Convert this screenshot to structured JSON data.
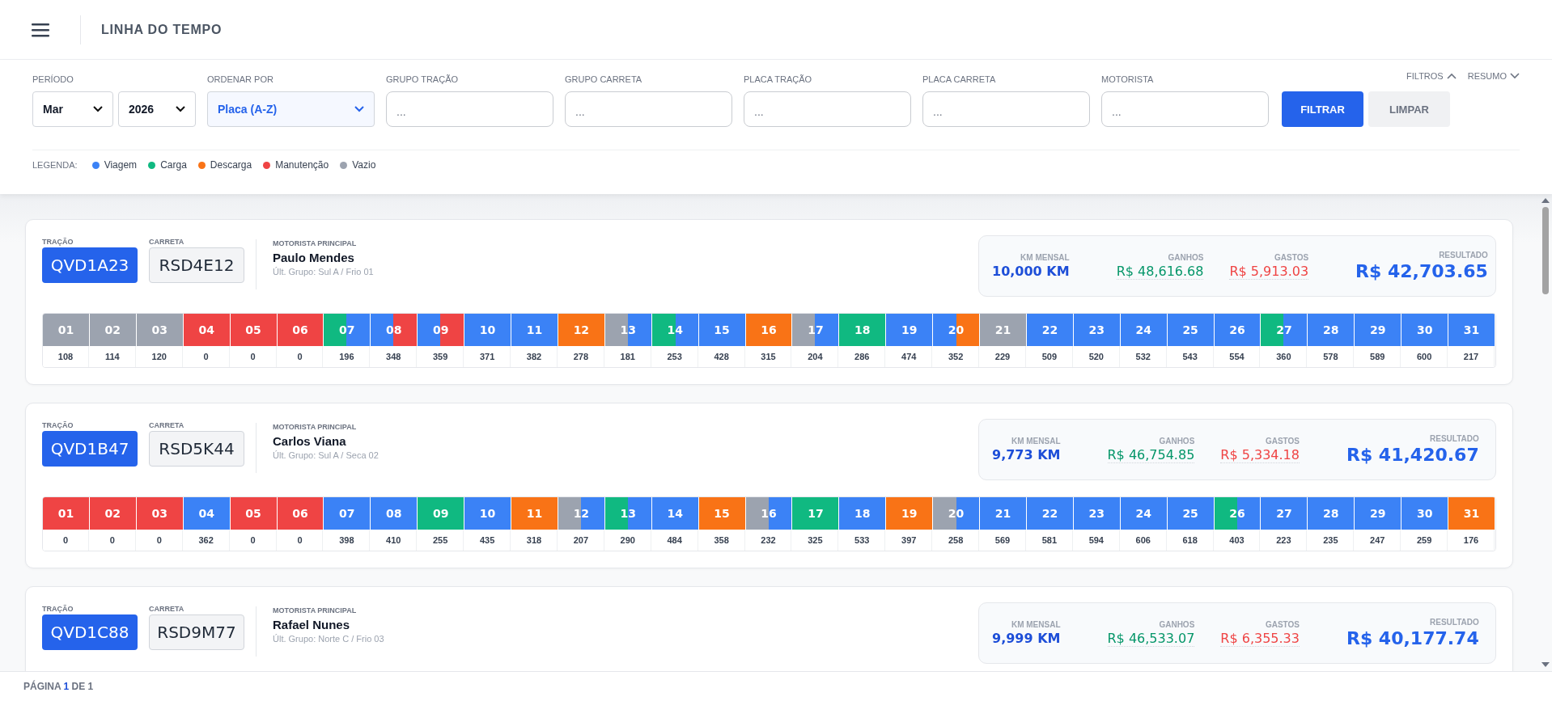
{
  "header": {
    "title": "LINHA DO TEMPO"
  },
  "filters": {
    "period_label": "PERÍODO",
    "month": "Mar",
    "year": "2026",
    "order_label": "ORDENAR POR",
    "order": "Placa (A-Z)",
    "fields": [
      {
        "label": "GRUPO TRAÇÃO",
        "placeholder": "..."
      },
      {
        "label": "GRUPO CARRETA",
        "placeholder": "..."
      },
      {
        "label": "PLACA TRAÇÃO",
        "placeholder": "..."
      },
      {
        "label": "PLACA CARRETA",
        "placeholder": "..."
      },
      {
        "label": "MOTORISTA",
        "placeholder": "..."
      }
    ],
    "filter_button": "FILTRAR",
    "clear_button": "LIMPAR",
    "toggles": [
      {
        "label": "FILTROS",
        "expanded": true
      },
      {
        "label": "RESUMO",
        "expanded": false
      }
    ]
  },
  "legend": {
    "label": "LEGENDA:",
    "items": [
      {
        "kind": "viagem",
        "label": "Viagem",
        "color": "#3b82f6"
      },
      {
        "kind": "carga",
        "label": "Carga",
        "color": "#10b981"
      },
      {
        "kind": "descarga",
        "label": "Descarga",
        "color": "#f97316"
      },
      {
        "kind": "manutencao",
        "label": "Manutenção",
        "color": "#ef4444"
      },
      {
        "kind": "vazio",
        "label": "Vazio",
        "color": "#9ca3af"
      }
    ]
  },
  "cards": [
    {
      "tracao_label": "TRAÇÃO",
      "tracao": "QVD1A23",
      "carreta_label": "CARRETA",
      "carreta": "RSD4E12",
      "driver_label": "MOTORISTA PRINCIPAL",
      "driver": "Paulo Mendes",
      "group": "Últ. Grupo: Sul A / Frio 01",
      "km_label": "KM MENSAL",
      "km": "10,000 KM",
      "gain_label": "GANHOS",
      "gain": "R$ 48,616.68",
      "cost_label": "GASTOS",
      "cost": "R$ 5,913.03",
      "result_label": "RESULTADO",
      "result": "R$ 42,703.65",
      "days": [
        {
          "day": "01",
          "km": "108",
          "segments": [
            {
              "kind": "vazio"
            }
          ]
        },
        {
          "day": "02",
          "km": "114",
          "segments": [
            {
              "kind": "vazio"
            }
          ]
        },
        {
          "day": "03",
          "km": "120",
          "segments": [
            {
              "kind": "vazio"
            }
          ]
        },
        {
          "day": "04",
          "km": "0",
          "segments": [
            {
              "kind": "manutencao"
            }
          ]
        },
        {
          "day": "05",
          "km": "0",
          "segments": [
            {
              "kind": "manutencao"
            }
          ]
        },
        {
          "day": "06",
          "km": "0",
          "segments": [
            {
              "kind": "manutencao"
            }
          ]
        },
        {
          "day": "07",
          "km": "196",
          "segments": [
            {
              "kind": "carga"
            },
            {
              "kind": "viagem"
            }
          ]
        },
        {
          "day": "08",
          "km": "348",
          "segments": [
            {
              "kind": "viagem"
            },
            {
              "kind": "manutencao"
            }
          ]
        },
        {
          "day": "09",
          "km": "359",
          "segments": [
            {
              "kind": "viagem"
            },
            {
              "kind": "manutencao"
            }
          ]
        },
        {
          "day": "10",
          "km": "371",
          "segments": [
            {
              "kind": "viagem"
            }
          ]
        },
        {
          "day": "11",
          "km": "382",
          "segments": [
            {
              "kind": "viagem"
            }
          ]
        },
        {
          "day": "12",
          "km": "278",
          "segments": [
            {
              "kind": "descarga"
            }
          ]
        },
        {
          "day": "13",
          "km": "181",
          "segments": [
            {
              "kind": "vazio"
            },
            {
              "kind": "viagem"
            }
          ]
        },
        {
          "day": "14",
          "km": "253",
          "segments": [
            {
              "kind": "carga"
            },
            {
              "kind": "viagem"
            }
          ]
        },
        {
          "day": "15",
          "km": "428",
          "segments": [
            {
              "kind": "viagem"
            }
          ]
        },
        {
          "day": "16",
          "km": "315",
          "segments": [
            {
              "kind": "descarga"
            }
          ]
        },
        {
          "day": "17",
          "km": "204",
          "segments": [
            {
              "kind": "vazio"
            },
            {
              "kind": "viagem"
            }
          ]
        },
        {
          "day": "18",
          "km": "286",
          "segments": [
            {
              "kind": "carga"
            }
          ]
        },
        {
          "day": "19",
          "km": "474",
          "segments": [
            {
              "kind": "viagem"
            }
          ]
        },
        {
          "day": "20",
          "km": "352",
          "segments": [
            {
              "kind": "viagem"
            },
            {
              "kind": "descarga"
            }
          ]
        },
        {
          "day": "21",
          "km": "229",
          "segments": [
            {
              "kind": "vazio"
            }
          ]
        },
        {
          "day": "22",
          "km": "509",
          "segments": [
            {
              "kind": "viagem"
            }
          ]
        },
        {
          "day": "23",
          "km": "520",
          "segments": [
            {
              "kind": "viagem"
            }
          ]
        },
        {
          "day": "24",
          "km": "532",
          "segments": [
            {
              "kind": "viagem"
            }
          ]
        },
        {
          "day": "25",
          "km": "543",
          "segments": [
            {
              "kind": "viagem"
            }
          ]
        },
        {
          "day": "26",
          "km": "554",
          "segments": [
            {
              "kind": "viagem"
            }
          ]
        },
        {
          "day": "27",
          "km": "360",
          "segments": [
            {
              "kind": "carga"
            },
            {
              "kind": "viagem"
            }
          ]
        },
        {
          "day": "28",
          "km": "578",
          "segments": [
            {
              "kind": "viagem"
            }
          ]
        },
        {
          "day": "29",
          "km": "589",
          "segments": [
            {
              "kind": "viagem"
            }
          ]
        },
        {
          "day": "30",
          "km": "600",
          "segments": [
            {
              "kind": "viagem"
            }
          ]
        },
        {
          "day": "31",
          "km": "217",
          "segments": [
            {
              "kind": "viagem"
            }
          ]
        }
      ]
    },
    {
      "tracao_label": "TRAÇÃO",
      "tracao": "QVD1B47",
      "carreta_label": "CARRETA",
      "carreta": "RSD5K44",
      "driver_label": "MOTORISTA PRINCIPAL",
      "driver": "Carlos Viana",
      "group": "Últ. Grupo: Sul A / Seca 02",
      "km_label": "KM MENSAL",
      "km": "9,773 KM",
      "gain_label": "GANHOS",
      "gain": "R$ 46,754.85",
      "cost_label": "GASTOS",
      "cost": "R$ 5,334.18",
      "result_label": "RESULTADO",
      "result": "R$ 41,420.67",
      "days": [
        {
          "day": "01",
          "km": "0",
          "segments": [
            {
              "kind": "manutencao"
            }
          ]
        },
        {
          "day": "02",
          "km": "0",
          "segments": [
            {
              "kind": "manutencao"
            }
          ]
        },
        {
          "day": "03",
          "km": "0",
          "segments": [
            {
              "kind": "manutencao"
            }
          ]
        },
        {
          "day": "04",
          "km": "362",
          "segments": [
            {
              "kind": "viagem"
            }
          ]
        },
        {
          "day": "05",
          "km": "0",
          "segments": [
            {
              "kind": "manutencao"
            }
          ]
        },
        {
          "day": "06",
          "km": "0",
          "segments": [
            {
              "kind": "manutencao"
            }
          ]
        },
        {
          "day": "07",
          "km": "398",
          "segments": [
            {
              "kind": "viagem"
            }
          ]
        },
        {
          "day": "08",
          "km": "410",
          "segments": [
            {
              "kind": "viagem"
            }
          ]
        },
        {
          "day": "09",
          "km": "255",
          "segments": [
            {
              "kind": "carga"
            }
          ]
        },
        {
          "day": "10",
          "km": "435",
          "segments": [
            {
              "kind": "viagem"
            }
          ]
        },
        {
          "day": "11",
          "km": "318",
          "segments": [
            {
              "kind": "descarga"
            }
          ]
        },
        {
          "day": "12",
          "km": "207",
          "segments": [
            {
              "kind": "vazio"
            },
            {
              "kind": "viagem"
            }
          ]
        },
        {
          "day": "13",
          "km": "290",
          "segments": [
            {
              "kind": "carga"
            },
            {
              "kind": "viagem"
            }
          ]
        },
        {
          "day": "14",
          "km": "484",
          "segments": [
            {
              "kind": "viagem"
            }
          ]
        },
        {
          "day": "15",
          "km": "358",
          "segments": [
            {
              "kind": "descarga"
            }
          ]
        },
        {
          "day": "16",
          "km": "232",
          "segments": [
            {
              "kind": "vazio"
            },
            {
              "kind": "viagem"
            }
          ]
        },
        {
          "day": "17",
          "km": "325",
          "segments": [
            {
              "kind": "carga"
            }
          ]
        },
        {
          "day": "18",
          "km": "533",
          "segments": [
            {
              "kind": "viagem"
            }
          ]
        },
        {
          "day": "19",
          "km": "397",
          "segments": [
            {
              "kind": "descarga"
            }
          ]
        },
        {
          "day": "20",
          "km": "258",
          "segments": [
            {
              "kind": "vazio"
            },
            {
              "kind": "viagem"
            }
          ]
        },
        {
          "day": "21",
          "km": "569",
          "segments": [
            {
              "kind": "viagem"
            }
          ]
        },
        {
          "day": "22",
          "km": "581",
          "segments": [
            {
              "kind": "viagem"
            }
          ]
        },
        {
          "day": "23",
          "km": "594",
          "segments": [
            {
              "kind": "viagem"
            }
          ]
        },
        {
          "day": "24",
          "km": "606",
          "segments": [
            {
              "kind": "viagem"
            }
          ]
        },
        {
          "day": "25",
          "km": "618",
          "segments": [
            {
              "kind": "viagem"
            }
          ]
        },
        {
          "day": "26",
          "km": "403",
          "segments": [
            {
              "kind": "carga"
            },
            {
              "kind": "viagem"
            }
          ]
        },
        {
          "day": "27",
          "km": "223",
          "segments": [
            {
              "kind": "viagem"
            }
          ]
        },
        {
          "day": "28",
          "km": "235",
          "segments": [
            {
              "kind": "viagem"
            }
          ]
        },
        {
          "day": "29",
          "km": "247",
          "segments": [
            {
              "kind": "viagem"
            }
          ]
        },
        {
          "day": "30",
          "km": "259",
          "segments": [
            {
              "kind": "viagem"
            }
          ]
        },
        {
          "day": "31",
          "km": "176",
          "segments": [
            {
              "kind": "descarga"
            }
          ]
        }
      ]
    },
    {
      "tracao_label": "TRAÇÃO",
      "tracao": "QVD1C88",
      "carreta_label": "CARRETA",
      "carreta": "RSD9M77",
      "driver_label": "MOTORISTA PRINCIPAL",
      "driver": "Rafael Nunes",
      "group": "Últ. Grupo: Norte C / Frio 03",
      "km_label": "KM MENSAL",
      "km": "9,999 KM",
      "gain_label": "GANHOS",
      "gain": "R$ 46,533.07",
      "cost_label": "GASTOS",
      "cost": "R$ 6,355.33",
      "result_label": "RESULTADO",
      "result": "R$ 40,177.74"
    }
  ],
  "footer": {
    "pagination": "PÁGINA **1** DE 1"
  }
}
